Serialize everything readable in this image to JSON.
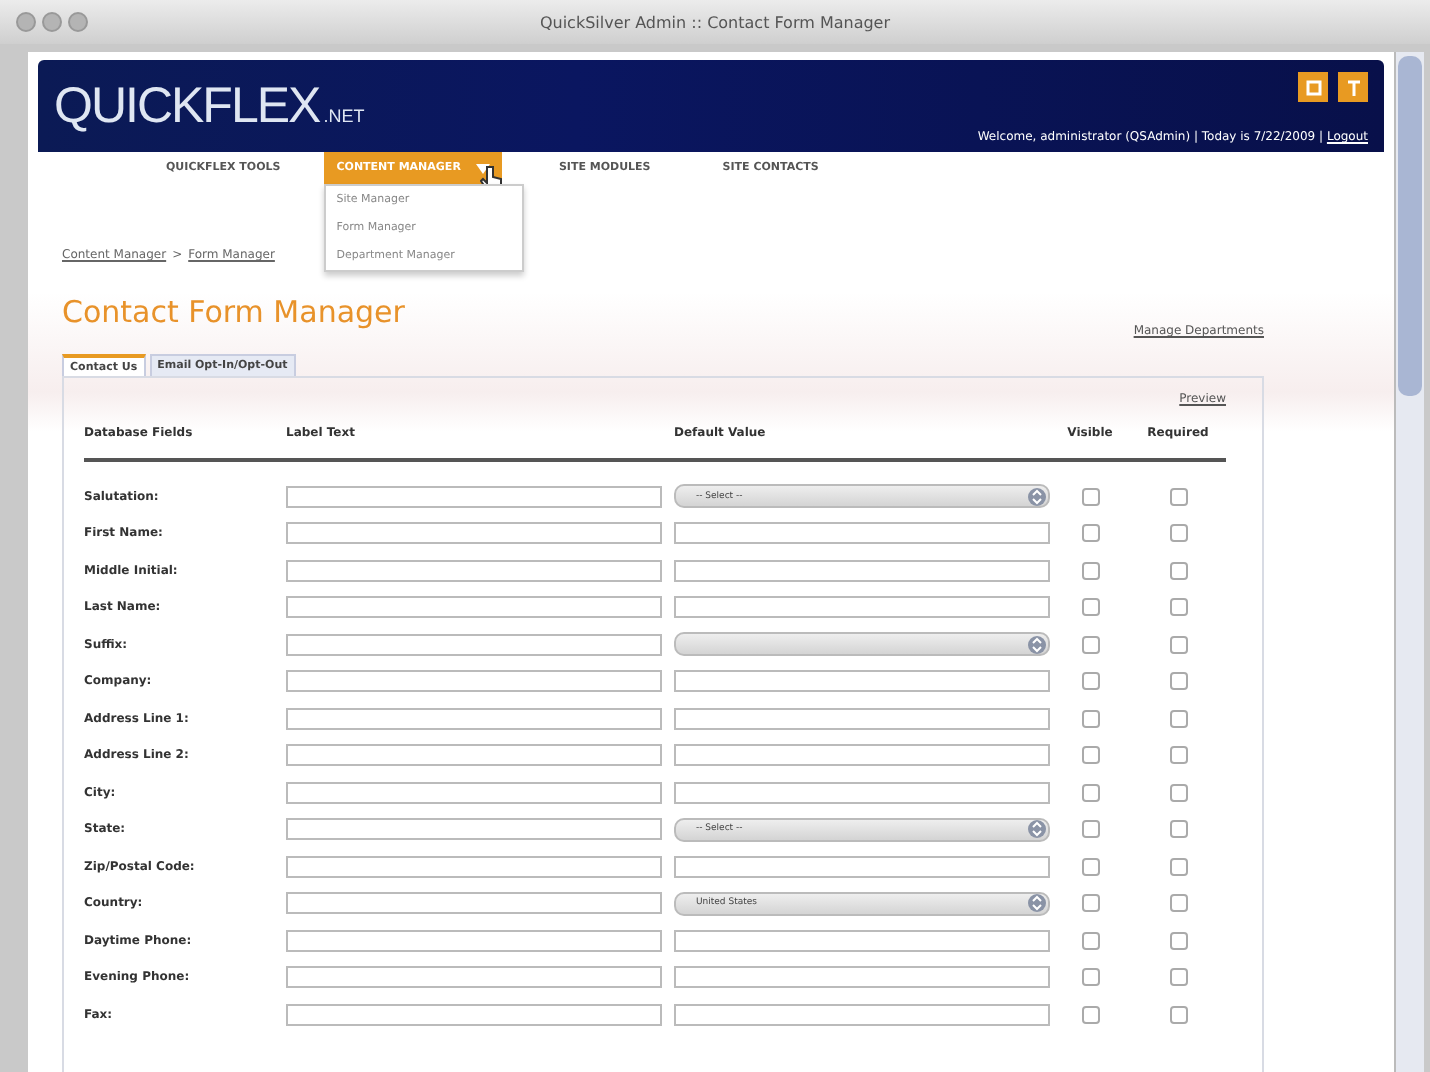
{
  "window": {
    "title": "QuickSilver Admin :: Contact Form Manager"
  },
  "header": {
    "logo": "QUICKFLEX",
    "logo_suffix": ".NET",
    "welcome": "Welcome, administrator (QSAdmin) | Today is 7/22/2009 |",
    "logout": "Logout"
  },
  "nav": [
    {
      "label": "QUICKFLEX TOOLS",
      "selected": false,
      "has_menu": false
    },
    {
      "label": "CONTENT MANAGER",
      "selected": true,
      "has_menu": true
    },
    {
      "label": "SITE MODULES",
      "selected": false,
      "has_menu": false
    },
    {
      "label": "SITE CONTACTS",
      "selected": false,
      "has_menu": false
    }
  ],
  "dropdown": {
    "open": true,
    "items": [
      "Site Manager",
      "Form Manager",
      "Department Manager"
    ]
  },
  "breadcrumb": [
    "Content Manager",
    "Form Manager"
  ],
  "breadcrumb_separator": ">",
  "page_title": "Contact Form Manager",
  "manage_link": "Manage Departments",
  "tabs": [
    {
      "label": "Contact Us",
      "selected": true
    },
    {
      "label": "Email Opt-In/Opt-Out",
      "selected": false
    }
  ],
  "preview_link": "Preview",
  "columns": [
    "Database Fields",
    "Label Text",
    "Default Value",
    "Visible",
    "Required"
  ],
  "rows": [
    {
      "field": "Salutation:",
      "kind": "select",
      "value": "-- Select --",
      "visible": false,
      "required": false
    },
    {
      "field": "First Name:",
      "kind": "text",
      "visible": false,
      "required": false
    },
    {
      "field": "Middle Initial:",
      "kind": "text",
      "visible": false,
      "required": false
    },
    {
      "field": "Last Name:",
      "kind": "text",
      "visible": false,
      "required": false
    },
    {
      "field": "Suffix:",
      "kind": "select",
      "visible": false,
      "required": false
    },
    {
      "field": "Company:",
      "kind": "text",
      "visible": false,
      "required": false
    },
    {
      "field": "Address Line 1:",
      "kind": "text",
      "visible": false,
      "required": false
    },
    {
      "field": "Address Line 2:",
      "kind": "text",
      "visible": false,
      "required": false
    },
    {
      "field": "City:",
      "kind": "text",
      "visible": false,
      "required": false
    },
    {
      "field": "State:",
      "kind": "select",
      "value": "-- Select --",
      "visible": false,
      "required": false
    },
    {
      "field": "Zip/Postal Code:",
      "kind": "text",
      "visible": false,
      "required": false
    },
    {
      "field": "Country:",
      "kind": "select",
      "value": "United States",
      "visible": false,
      "required": false
    },
    {
      "field": "Daytime Phone:",
      "kind": "text",
      "visible": false,
      "required": false
    },
    {
      "field": "Evening Phone:",
      "kind": "text",
      "visible": false,
      "required": false
    },
    {
      "field": "Fax:",
      "kind": "text",
      "visible": false,
      "required": false
    }
  ]
}
